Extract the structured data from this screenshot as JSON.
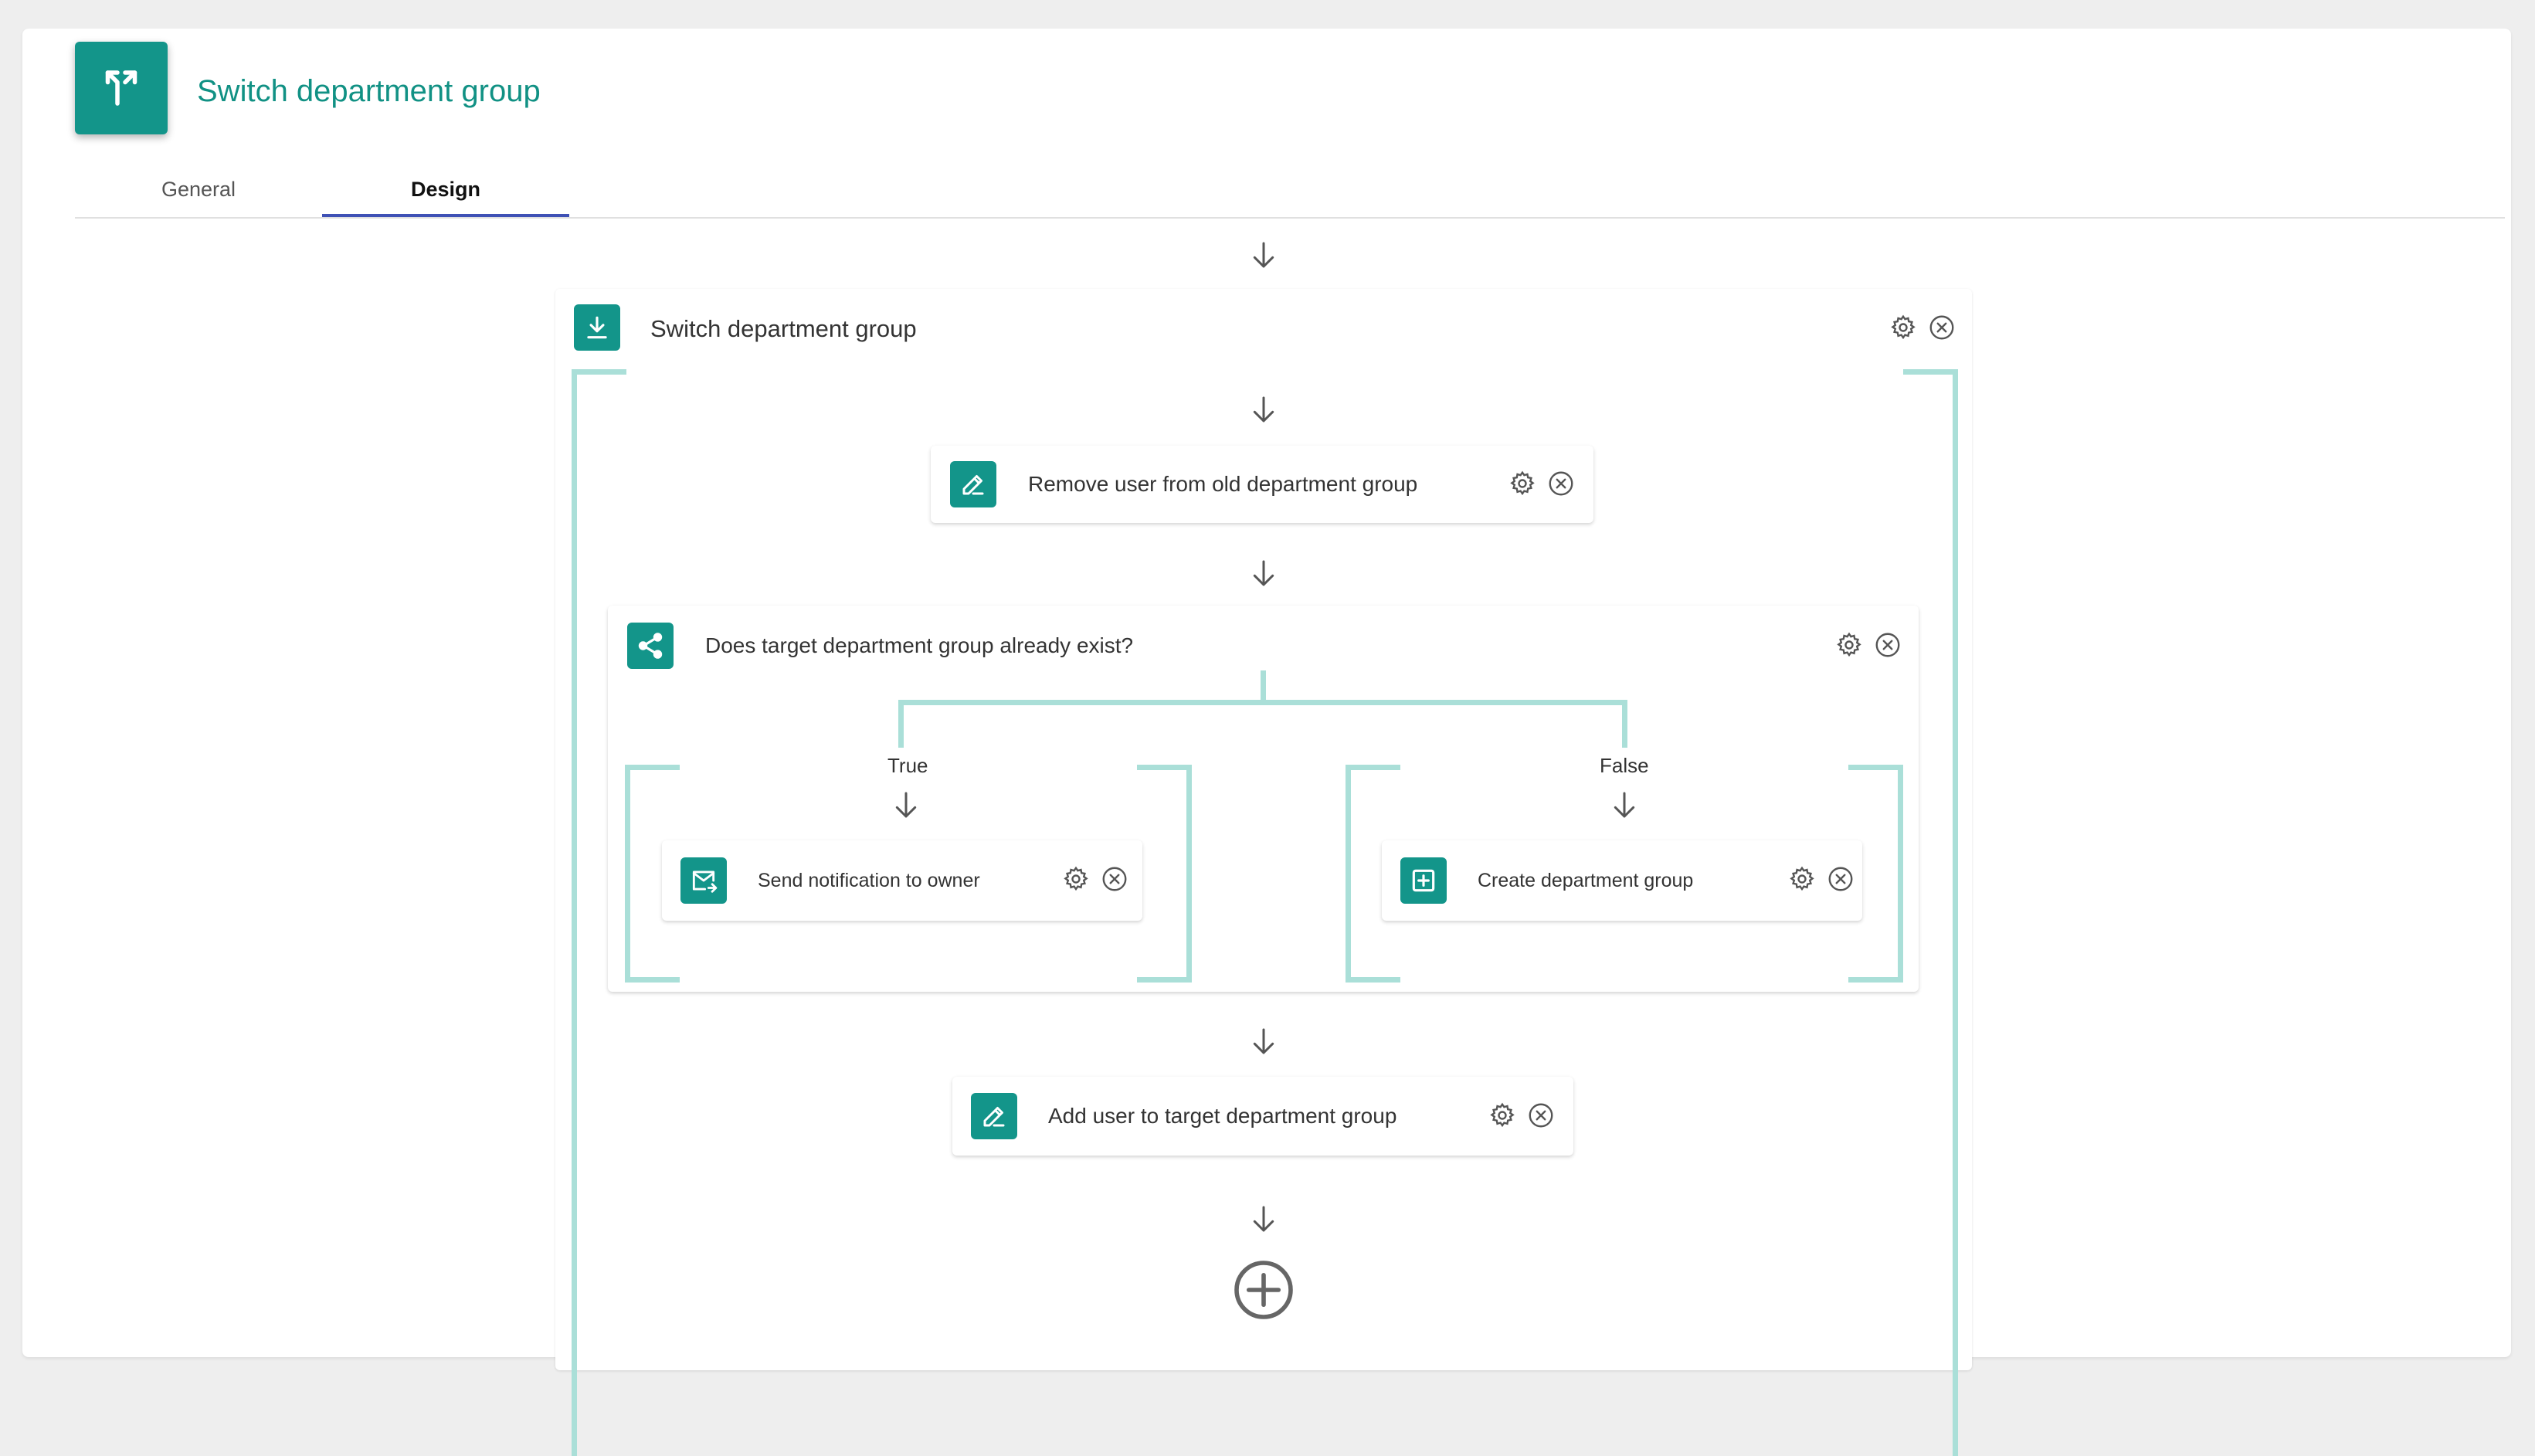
{
  "header": {
    "title": "Switch department group",
    "icon": "split-arrows-icon",
    "accent": "#13958a"
  },
  "tabs": [
    {
      "label": "General",
      "active": false
    },
    {
      "label": "Design",
      "active": true
    }
  ],
  "workflow": {
    "container": {
      "label": "Switch department group",
      "icon": "download-icon"
    },
    "steps": [
      {
        "label": "Remove user from old department group",
        "icon": "edit-icon"
      },
      {
        "label": "Add user to target department group",
        "icon": "edit-icon"
      }
    ],
    "condition": {
      "label": "Does target department group already exist?",
      "icon": "share-icon",
      "true_branch": {
        "label": "True",
        "step": {
          "label": "Send notification to owner",
          "icon": "mail-forward-icon"
        }
      },
      "false_branch": {
        "label": "False",
        "step": {
          "label": "Create department group",
          "icon": "add-box-icon"
        }
      }
    }
  },
  "colors": {
    "accent": "#13958a",
    "connector": "#aadfd8",
    "tab_indicator": "#3f51b5"
  }
}
